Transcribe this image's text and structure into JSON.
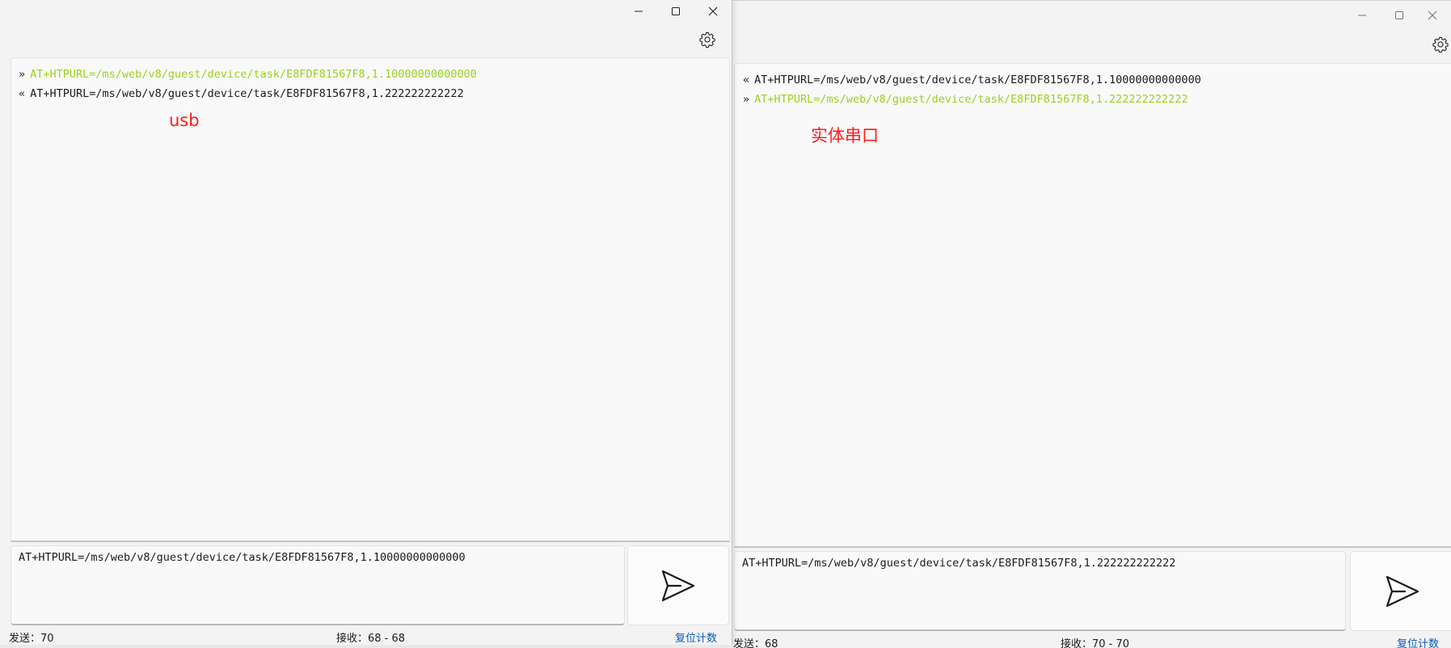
{
  "left_window": {
    "log": [
      {
        "direction": "»",
        "text": "AT+HTPURL=/ms/web/v8/guest/device/task/E8FDF81567F8,1.10000000000000",
        "kind": "sent"
      },
      {
        "direction": "«",
        "text": "AT+HTPURL=/ms/web/v8/guest/device/task/E8FDF81567F8,1.222222222222",
        "kind": "received"
      }
    ],
    "annotation": "usb",
    "input_value": "AT+HTPURL=/ms/web/v8/guest/device/task/E8FDF81567F8,1.10000000000000",
    "status": {
      "sent": "发送：70",
      "received": "接收：68 - 68",
      "reset_label": "复位计数"
    }
  },
  "right_window": {
    "log": [
      {
        "direction": "«",
        "text": "AT+HTPURL=/ms/web/v8/guest/device/task/E8FDF81567F8,1.10000000000000",
        "kind": "received"
      },
      {
        "direction": "»",
        "text": "AT+HTPURL=/ms/web/v8/guest/device/task/E8FDF81567F8,1.222222222222",
        "kind": "sent"
      }
    ],
    "annotation": "实体串口",
    "input_value": "AT+HTPURL=/ms/web/v8/guest/device/task/E8FDF81567F8,1.222222222222",
    "status": {
      "sent": "发送：68",
      "received": "接收：70 - 70",
      "reset_label": "复位计数"
    }
  },
  "colors": {
    "sent_text": "#9ad21e",
    "received_text": "#1b1b1b",
    "annotation": "#ff1a1a",
    "reset_link": "#0a5bb8"
  },
  "icons": {
    "minimize": "minimize-icon",
    "maximize": "maximize-icon",
    "close": "close-icon",
    "settings": "gear-icon",
    "send": "send-icon"
  }
}
